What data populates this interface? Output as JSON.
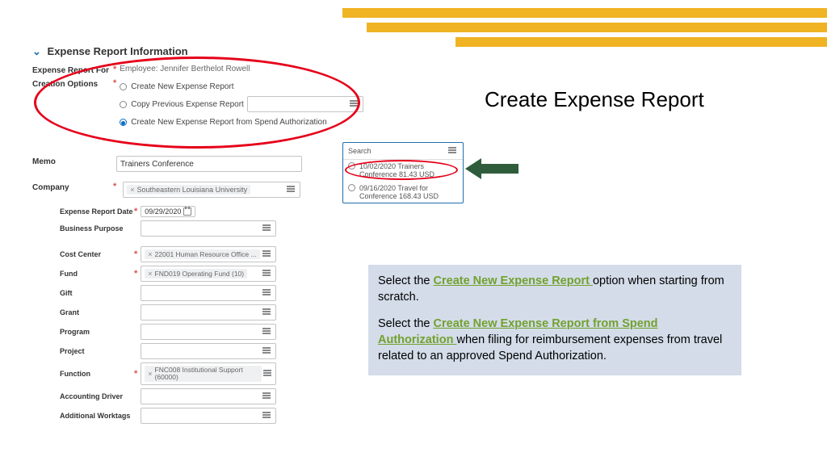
{
  "slide": {
    "title": "Create Expense Report",
    "instructions": {
      "line1_a": "Select the ",
      "line1_link": "Create New Expense Report ",
      "line1_b": "option when starting from scratch.",
      "line2_a": "Select the ",
      "line2_link": "Create New Expense Report from Spend Authorization ",
      "line2_b": "when filing for reimbursement expenses from travel related to an approved Spend Authorization."
    }
  },
  "form": {
    "section_title": "Expense Report Information",
    "for_label": "Expense Report For",
    "for_value": "Employee: Jennifer Berthelot Rowell",
    "creation_label": "Creation Options",
    "opt1": "Create New Expense Report",
    "opt2": "Copy Previous Expense Report",
    "opt3": "Create New Expense Report from Spend Authorization",
    "memo_label": "Memo",
    "memo_value": "Trainers Conference",
    "company_label": "Company",
    "company_value": "Southeastern Louisiana University",
    "date_label": "Expense Report Date",
    "date_value": "09/29/2020",
    "bp_label": "Business Purpose",
    "cc_label": "Cost Center",
    "cc_value": "22001 Human Resource Office ...",
    "fund_label": "Fund",
    "fund_value": "FND019 Operating Fund (10)",
    "gift_label": "Gift",
    "grant_label": "Grant",
    "program_label": "Program",
    "project_label": "Project",
    "function_label": "Function",
    "function_value": "FNC008 Institutional Support (60000)",
    "acct_driver_label": "Accounting Driver",
    "addl_worktags_label": "Additional Worktags"
  },
  "search_popup": {
    "head": "Search",
    "opt1": "10/02/2020 Trainers Conference 81.43 USD",
    "opt2": "09/16/2020 Travel for Conference 168.43 USD"
  }
}
